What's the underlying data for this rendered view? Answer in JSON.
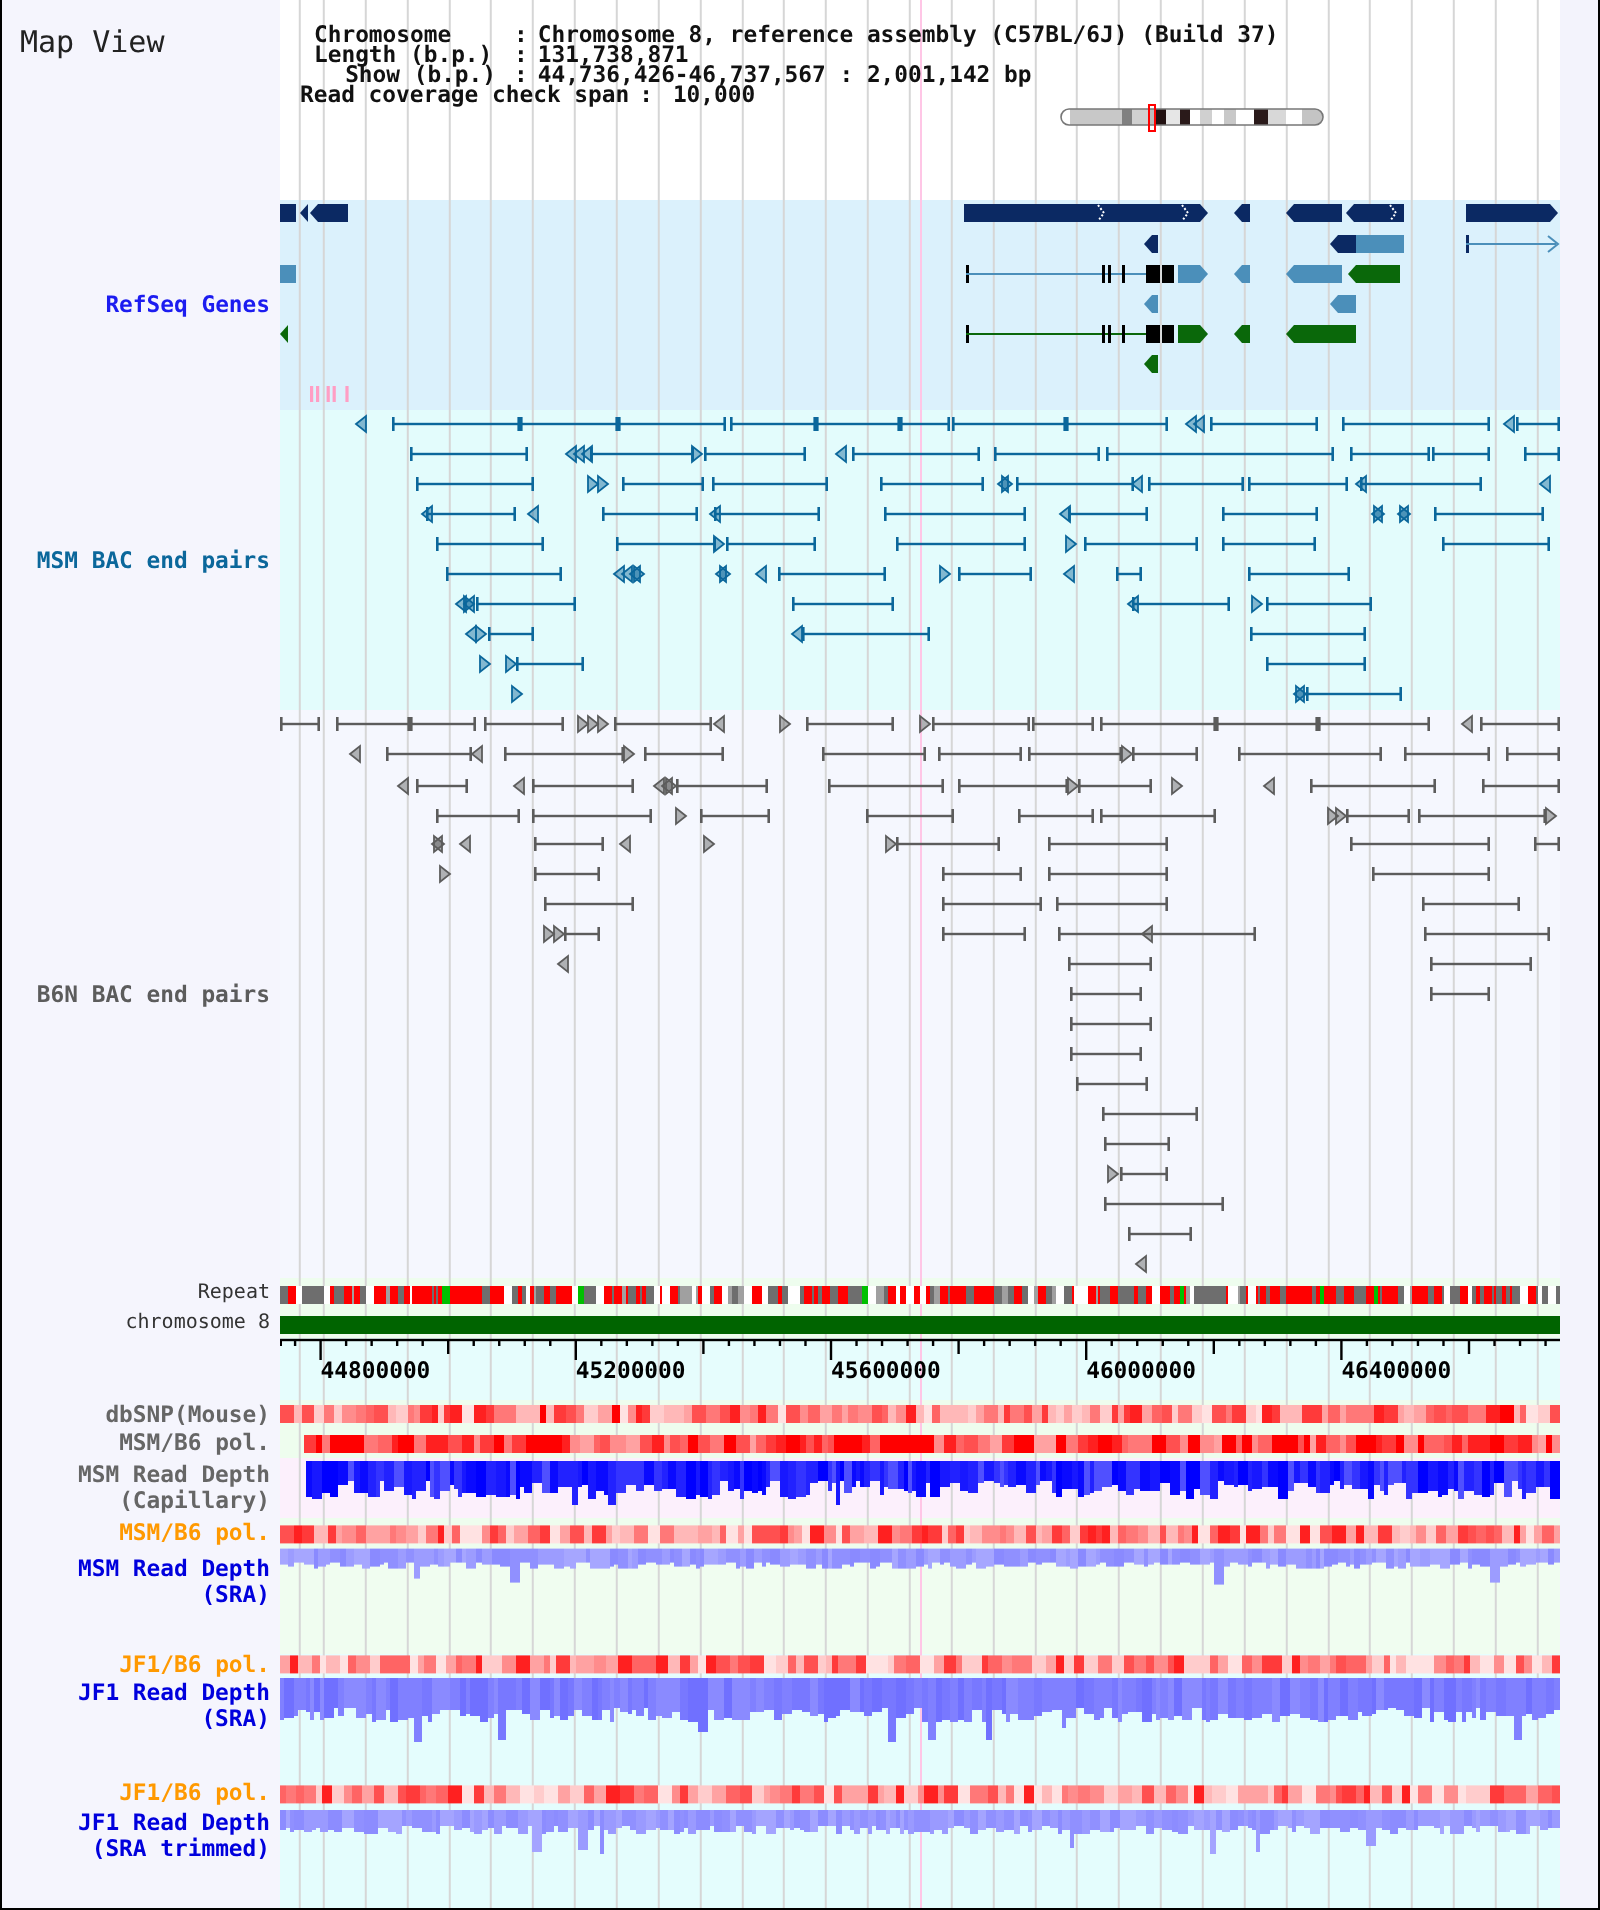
{
  "title": "Map View",
  "info": [
    {
      "label": "Chromosome",
      "separator": ":",
      "value": "Chromosome 8, reference assembly (C57BL/6J) (Build 37)"
    },
    {
      "label": "Length (b.p.)",
      "separator": ":",
      "value": "131,738,871"
    },
    {
      "label": "Show (b.p.)",
      "separator": ":",
      "value": "44,736,426-46,737,567 : 2,001,142 bp"
    },
    {
      "label": "Read coverage check span",
      "separator": ":",
      "value": "10,000"
    }
  ],
  "upper_tracks": [
    {
      "kind": "genes",
      "label": "RefSeq Genes",
      "color": "#1c1cf0"
    },
    {
      "kind": "bacpairs",
      "label": "MSM BAC end pairs",
      "color": "#0b679b"
    },
    {
      "kind": "bacpairs",
      "label": "B6N BAC end pairs",
      "color": "#5c5c5c"
    },
    {
      "kind": "repeat",
      "label": "Repeat",
      "color": "#333333"
    },
    {
      "kind": "chromosome",
      "label": "chromosome 8",
      "color": "#333333"
    }
  ],
  "axis": {
    "ticks": [
      "44800000",
      "45200000",
      "45600000",
      "46000000",
      "46400000"
    ]
  },
  "lower_tracks": [
    {
      "kind": "heatmap",
      "label": "dbSNP(Mouse)",
      "color": "#666666"
    },
    {
      "kind": "heatmap",
      "label": "MSM/B6 pol.",
      "color": "#666666"
    },
    {
      "kind": "depth",
      "label": "MSM Read Depth (Capillary)",
      "color": "#666666"
    },
    {
      "kind": "heatmap",
      "label": "MSM/B6 pol.",
      "color": "#ff9900"
    },
    {
      "kind": "depth",
      "label": "MSM Read Depth (SRA)",
      "color": "#0000dd"
    },
    {
      "kind": "heatmap",
      "label": "JF1/B6 pol.",
      "color": "#ff9900"
    },
    {
      "kind": "depth",
      "label": "JF1 Read Depth (SRA)",
      "color": "#0000dd"
    },
    {
      "kind": "heatmap",
      "label": "JF1/B6 pol.",
      "color": "#ff9900"
    },
    {
      "kind": "depth",
      "label": "JF1 Read Depth (SRA trimmed)",
      "color": "#0000dd"
    }
  ]
}
